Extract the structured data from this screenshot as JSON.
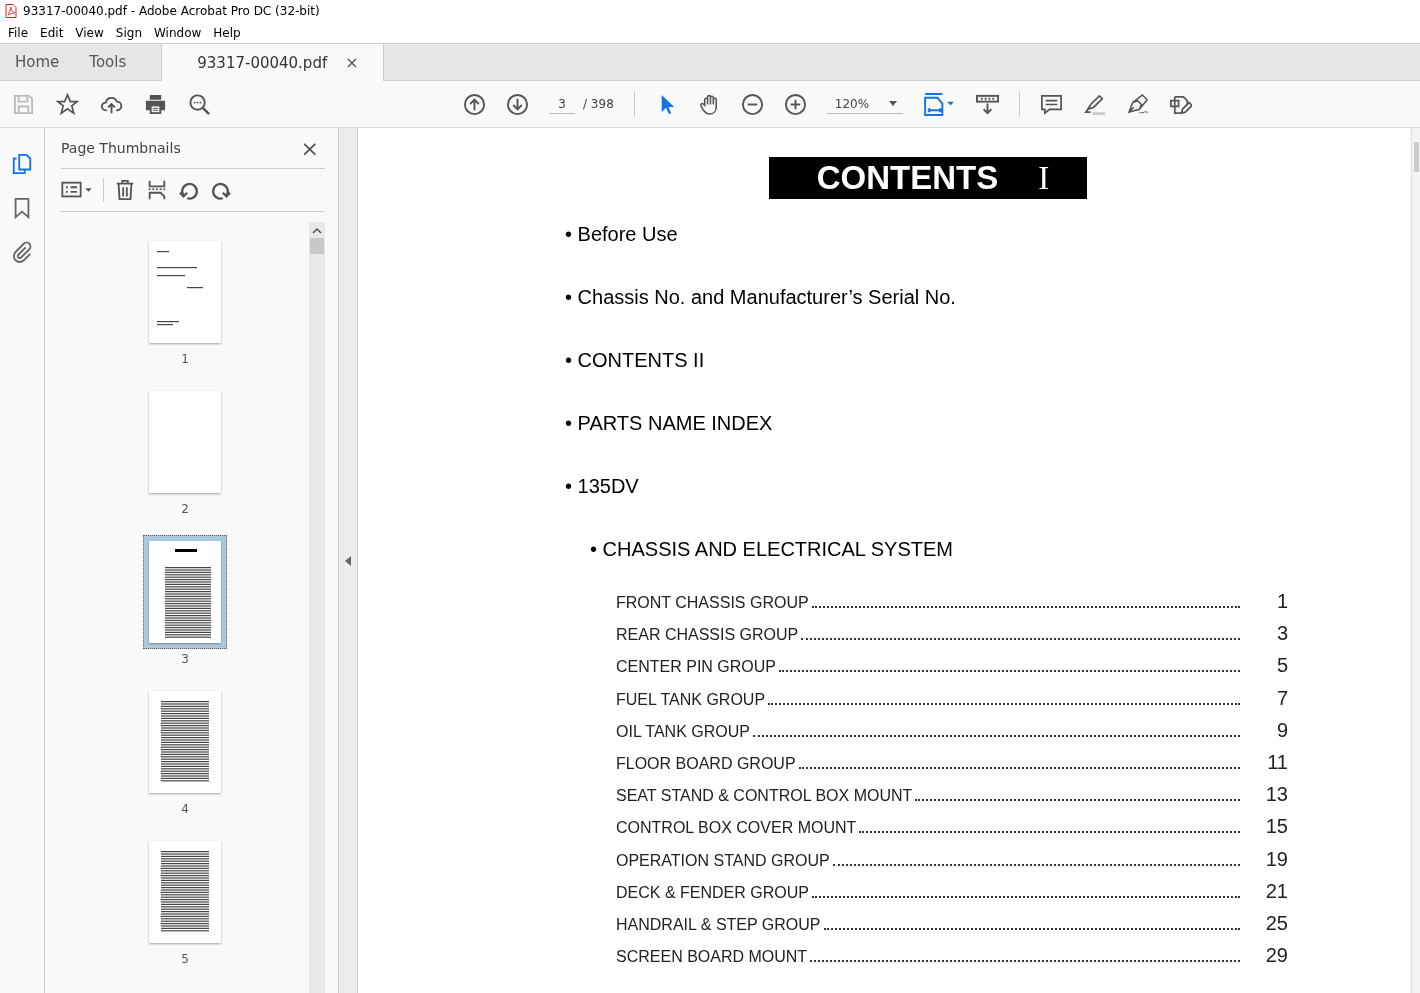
{
  "window": {
    "title": "93317-00040.pdf - Adobe Acrobat Pro DC (32-bit)"
  },
  "menu": [
    "File",
    "Edit",
    "View",
    "Sign",
    "Window",
    "Help"
  ],
  "tabs": [
    {
      "label": "Home",
      "selected": false
    },
    {
      "label": "Tools",
      "selected": false
    },
    {
      "label": "93317-00040.pdf",
      "selected": true,
      "close": "×"
    }
  ],
  "toolbar": {
    "page": "3",
    "page_total": "/ 398",
    "zoom": "120%"
  },
  "rail": [
    {
      "kind": "pages",
      "selected": true
    },
    {
      "kind": "bookmarks",
      "selected": false
    },
    {
      "kind": "attachments",
      "selected": false
    }
  ],
  "thumbnails_panel": {
    "title": "Page Thumbnails",
    "close": "×",
    "pages": [
      {
        "label": "1",
        "kind": "cover",
        "selected": false
      },
      {
        "label": "2",
        "kind": "blank",
        "selected": false
      },
      {
        "label": "3",
        "kind": "contents",
        "selected": true
      },
      {
        "label": "4",
        "kind": "list",
        "selected": false
      },
      {
        "label": "5",
        "kind": "list",
        "selected": false
      }
    ]
  },
  "document": {
    "heading": "CONTENTS",
    "heading_numeral": "I",
    "sections": [
      {
        "text": "• Before Use",
        "kind": "section"
      },
      {
        "text": "• Chassis No.  and Manufacturer’s Serial No.",
        "kind": "section"
      },
      {
        "text": "• CONTENTS II",
        "kind": "section"
      },
      {
        "text": "• PARTS NAME INDEX",
        "kind": "section"
      },
      {
        "text": "• 135DV",
        "kind": "section"
      },
      {
        "text": "• CHASSIS AND ELECTRICAL SYSTEM",
        "kind": "subsection"
      }
    ],
    "entries": [
      {
        "label": "FRONT CHASSIS GROUP",
        "page": "1"
      },
      {
        "label": "REAR CHASSIS GROUP",
        "page": "3"
      },
      {
        "label": "CENTER PIN GROUP",
        "page": "5"
      },
      {
        "label": "FUEL TANK GROUP",
        "page": "7"
      },
      {
        "label": "OIL TANK GROUP",
        "page": "9"
      },
      {
        "label": "FLOOR BOARD GROUP",
        "page": "11"
      },
      {
        "label": "SEAT STAND & CONTROL BOX MOUNT",
        "page": "13"
      },
      {
        "label": "CONTROL BOX COVER MOUNT",
        "page": "15"
      },
      {
        "label": "OPERATION STAND GROUP",
        "page": "19"
      },
      {
        "label": "DECK & FENDER GROUP",
        "page": "21"
      },
      {
        "label": "HANDRAIL & STEP GROUP",
        "page": "25"
      },
      {
        "label": "SCREEN BOARD MOUNT",
        "page": "29"
      }
    ]
  }
}
